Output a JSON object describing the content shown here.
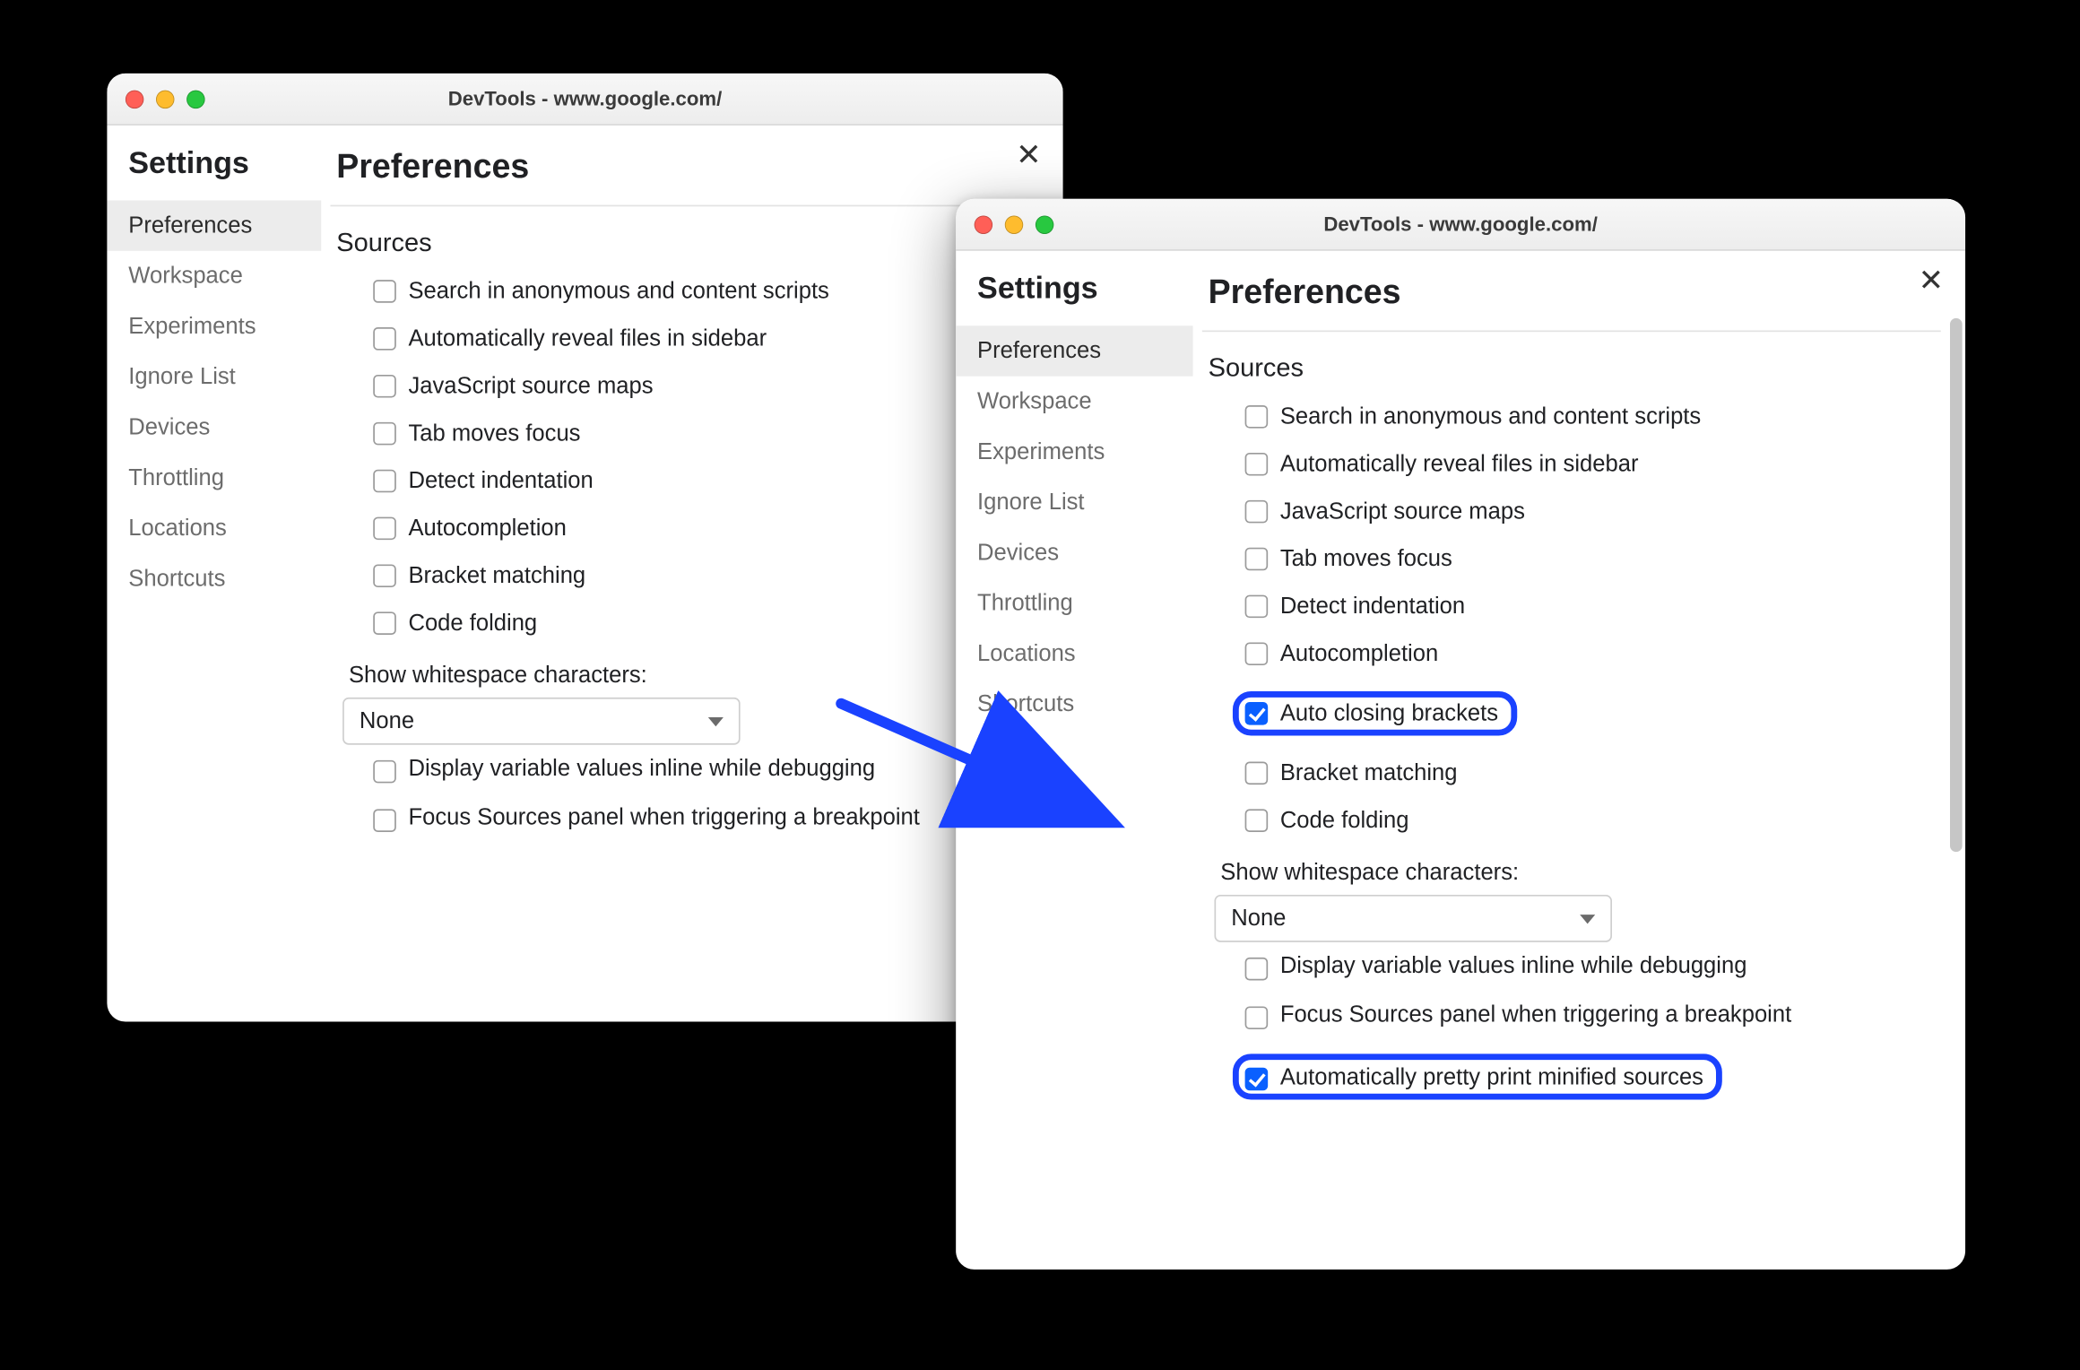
{
  "window_title": "DevTools - www.google.com/",
  "sidebar": {
    "title": "Settings",
    "items": [
      "Preferences",
      "Workspace",
      "Experiments",
      "Ignore List",
      "Devices",
      "Throttling",
      "Locations",
      "Shortcuts"
    ],
    "active_index": 0
  },
  "main": {
    "title": "Preferences",
    "section": "Sources",
    "select_label": "Show whitespace characters:",
    "select_value": "None"
  },
  "left_options": [
    {
      "label": "Search in anonymous and content scripts",
      "checked": false
    },
    {
      "label": "Automatically reveal files in sidebar",
      "checked": false
    },
    {
      "label": "JavaScript source maps",
      "checked": false
    },
    {
      "label": "Tab moves focus",
      "checked": false
    },
    {
      "label": "Detect indentation",
      "checked": false
    },
    {
      "label": "Autocompletion",
      "checked": false
    },
    {
      "label": "Bracket matching",
      "checked": false
    },
    {
      "label": "Code folding",
      "checked": false
    }
  ],
  "left_extra": [
    {
      "label": "Display variable values inline while debugging",
      "checked": false
    },
    {
      "label": "Focus Sources panel when triggering a breakpoint",
      "checked": false
    }
  ],
  "right_options": [
    {
      "label": "Search in anonymous and content scripts",
      "checked": false
    },
    {
      "label": "Automatically reveal files in sidebar",
      "checked": false
    },
    {
      "label": "JavaScript source maps",
      "checked": false
    },
    {
      "label": "Tab moves focus",
      "checked": false
    },
    {
      "label": "Detect indentation",
      "checked": false
    },
    {
      "label": "Autocompletion",
      "checked": false
    },
    {
      "label": "Auto closing brackets",
      "checked": true,
      "highlight": true
    },
    {
      "label": "Bracket matching",
      "checked": false
    },
    {
      "label": "Code folding",
      "checked": false
    }
  ],
  "right_extra": [
    {
      "label": "Display variable values inline while debugging",
      "checked": false
    },
    {
      "label": "Focus Sources panel when triggering a breakpoint",
      "checked": false
    },
    {
      "label": "Automatically pretty print minified sources",
      "checked": true,
      "highlight": true
    }
  ],
  "colors": {
    "accent": "#0a60ff",
    "annotation": "#1a42ff"
  }
}
